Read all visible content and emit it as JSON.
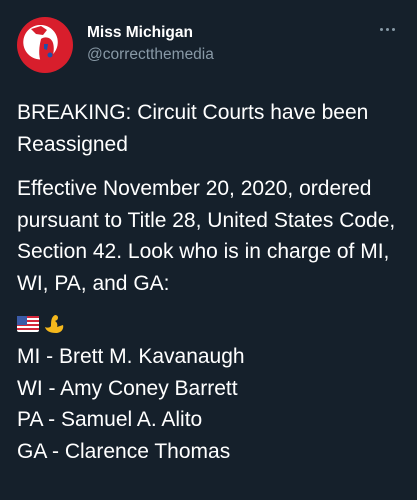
{
  "author": {
    "display_name": "Miss Michigan",
    "handle": "@correctthemedia"
  },
  "icons": {
    "avatar": "michigan-map-avatar",
    "more": "more-horizontal-icon",
    "emoji_1": "us-flag-emoji",
    "emoji_2": "flexed-biceps-emoji"
  },
  "tweet": {
    "paragraph_1": "BREAKING: Circuit Courts have been Reassigned",
    "paragraph_2": "Effective November 20, 2020, ordered pursuant to Title 28, United States Code, Section 42. Look who is in charge of MI, WI, PA, and GA:",
    "assignments": [
      "MI - Brett M. Kavanaugh",
      "WI - Amy Coney Barrett",
      "PA - Samuel A. Alito",
      "GA - Clarence Thomas"
    ]
  },
  "colors": {
    "background": "#15202b",
    "primary_text": "#ffffff",
    "secondary_text": "#8899a6"
  }
}
